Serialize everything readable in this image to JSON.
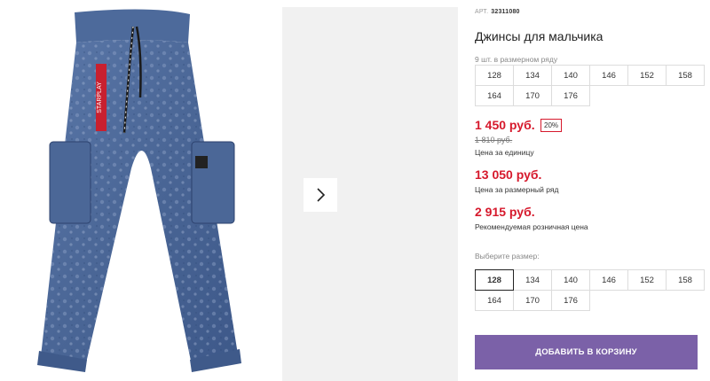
{
  "product": {
    "article_label": "АРТ.",
    "article_value": "32311080",
    "title": "Джинсы для мальчика",
    "brand_tag": "STARPLAY"
  },
  "pack": {
    "label": "9 шт. в размерном ряду",
    "sizes": [
      "128",
      "134",
      "140",
      "146",
      "152",
      "158",
      "164",
      "170",
      "176"
    ]
  },
  "prices": {
    "unit_price": "1 450 руб.",
    "discount_badge": "20%",
    "old_price": "1 810 руб.",
    "unit_caption": "Цена за единицу",
    "pack_price": "13 050 руб.",
    "pack_caption": "Цена за размерный ряд",
    "retail_price": "2 915 руб.",
    "retail_caption": "Рекомендуемая розничная цена"
  },
  "size_picker": {
    "label": "Выберите размер:",
    "selected": "128",
    "sizes": [
      "128",
      "134",
      "140",
      "146",
      "152",
      "158",
      "164",
      "170",
      "176"
    ]
  },
  "actions": {
    "add_to_cart": "ДОБАВИТЬ В КОРЗИНУ"
  },
  "icons": {
    "next": "chevron-right-icon"
  },
  "colors": {
    "price_red": "#d6192c",
    "button_purple": "#7b61a8",
    "denim": "#4a6696"
  }
}
